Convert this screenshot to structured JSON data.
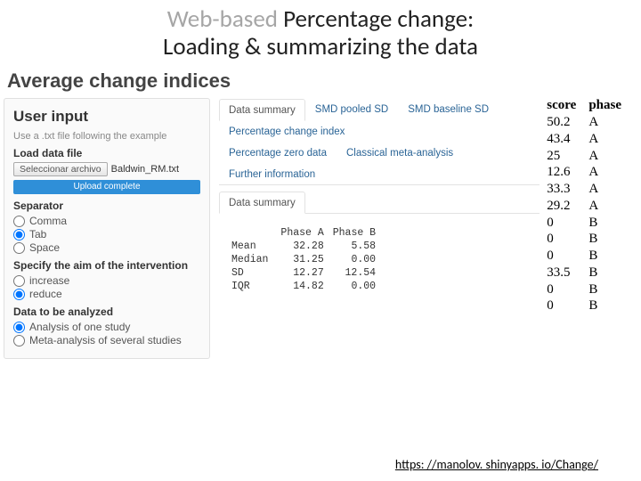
{
  "slide_title": {
    "prefix_grey": "Web-based ",
    "rest_line1": "Percentage change:",
    "line2": "Loading & summarizing the data"
  },
  "app": {
    "heading": "Average change indices",
    "sidebar": {
      "title": "User input",
      "hint": "Use a .txt file following the example",
      "load_label": "Load data file",
      "file_button": "Seleccionar archivo",
      "file_name": "Baldwin_RM.txt",
      "upload_status": "Upload complete",
      "separator_label": "Separator",
      "separator_options": [
        {
          "value": "comma",
          "label": "Comma",
          "checked": false
        },
        {
          "value": "tab",
          "label": "Tab",
          "checked": true
        },
        {
          "value": "space",
          "label": "Space",
          "checked": false
        }
      ],
      "aim_label": "Specify the aim of the intervention",
      "aim_options": [
        {
          "value": "increase",
          "label": "increase",
          "checked": false
        },
        {
          "value": "reduce",
          "label": "reduce",
          "checked": true
        }
      ],
      "analyze_label": "Data to be analyzed",
      "analyze_options": [
        {
          "value": "one",
          "label": "Analysis of one study",
          "checked": true
        },
        {
          "value": "meta",
          "label": "Meta-analysis of several studies",
          "checked": false
        }
      ]
    },
    "tabs_row1": [
      {
        "id": "data-summary",
        "label": "Data summary",
        "active": true
      },
      {
        "id": "smd-pooled",
        "label": "SMD pooled SD",
        "active": false
      },
      {
        "id": "smd-baseline",
        "label": "SMD baseline SD",
        "active": false
      },
      {
        "id": "pct-change",
        "label": "Percentage change index",
        "active": false
      }
    ],
    "tabs_row2": [
      {
        "id": "pct-zero",
        "label": "Percentage zero data",
        "active": false
      },
      {
        "id": "classical",
        "label": "Classical meta-analysis",
        "active": false
      },
      {
        "id": "further",
        "label": "Further information",
        "active": false
      }
    ],
    "subtab": {
      "label": "Data summary"
    },
    "stats": {
      "headers": [
        "",
        "Phase A",
        "Phase B"
      ],
      "rows": [
        {
          "name": "Mean",
          "a": "32.28",
          "b": "5.58"
        },
        {
          "name": "Median",
          "a": "31.25",
          "b": "0.00"
        },
        {
          "name": "SD",
          "a": "12.27",
          "b": "12.54"
        },
        {
          "name": "IQR",
          "a": "14.82",
          "b": "0.00"
        }
      ]
    },
    "raw_data": {
      "score_header": "score",
      "phase_header": "phase",
      "rows": [
        {
          "score": "50.2",
          "phase": "A"
        },
        {
          "score": "43.4",
          "phase": "A"
        },
        {
          "score": "25",
          "phase": "A"
        },
        {
          "score": "12.6",
          "phase": "A"
        },
        {
          "score": "33.3",
          "phase": "A"
        },
        {
          "score": "29.2",
          "phase": "A"
        },
        {
          "score": "0",
          "phase": "B"
        },
        {
          "score": "0",
          "phase": "B"
        },
        {
          "score": "0",
          "phase": "B"
        },
        {
          "score": "33.5",
          "phase": "B"
        },
        {
          "score": "0",
          "phase": "B"
        },
        {
          "score": "0",
          "phase": "B"
        }
      ]
    }
  },
  "footer": {
    "url_text": "https: //manolov. shinyapps. io/Change/",
    "url_href": "https://manolov.shinyapps.io/Change/"
  }
}
